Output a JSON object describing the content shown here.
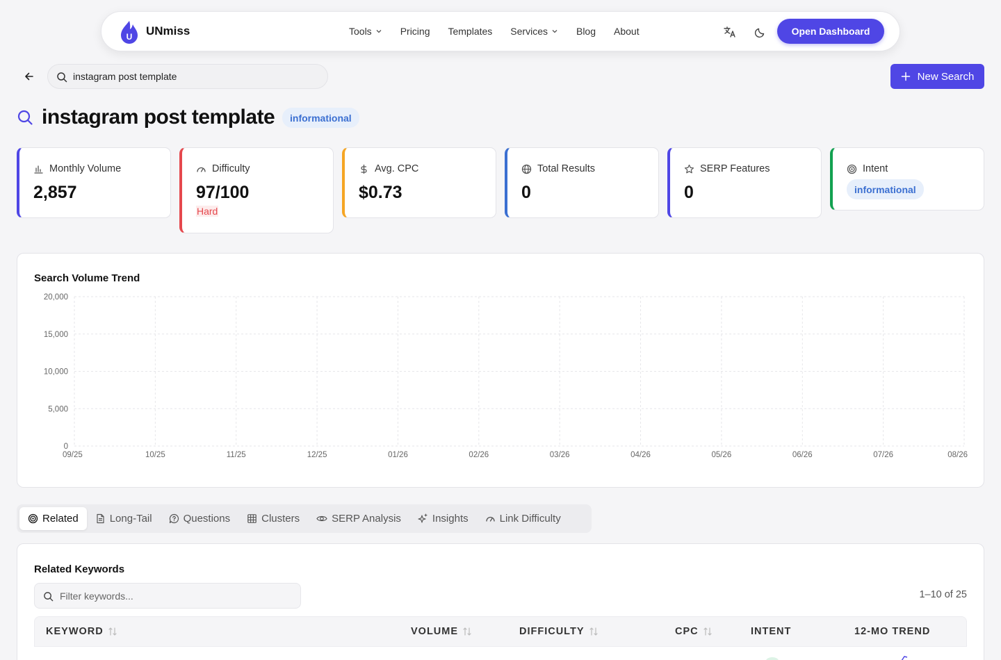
{
  "nav": {
    "brand": "UNmiss",
    "logo_letter": "U",
    "menu": [
      {
        "label": "Tools",
        "dropdown": true
      },
      {
        "label": "Pricing",
        "dropdown": false
      },
      {
        "label": "Templates",
        "dropdown": false
      },
      {
        "label": "Services",
        "dropdown": true
      },
      {
        "label": "Blog",
        "dropdown": false
      },
      {
        "label": "About",
        "dropdown": false
      }
    ],
    "icons": [
      "translate-icon",
      "moon-icon"
    ],
    "cta": "Open Dashboard"
  },
  "search": {
    "value": "instagram post template",
    "new_search": "New Search"
  },
  "page": {
    "title": "instagram post template",
    "intent_badge": "informational"
  },
  "stats": [
    {
      "label": "Monthly Volume",
      "value": "2,857",
      "icon": "bar-chart-icon",
      "color": "#4f46e5"
    },
    {
      "label": "Difficulty",
      "value": "97/100",
      "sub": "Hard",
      "icon": "gauge-icon",
      "color": "#e5484d"
    },
    {
      "label": "Avg. CPC",
      "value": "$0.73",
      "icon": "dollar-icon",
      "color": "#f5a524"
    },
    {
      "label": "Total Results",
      "value": "0",
      "icon": "globe-icon",
      "color": "#3b6fd1"
    },
    {
      "label": "SERP Features",
      "value": "0",
      "icon": "star-icon",
      "color": "#4f46e5"
    },
    {
      "label": "Intent",
      "badge": "informational",
      "icon": "target-icon",
      "color": "#12a150"
    }
  ],
  "chart_data": {
    "type": "area",
    "title": "Search Volume Trend",
    "x": [
      "09/25",
      "10/25",
      "11/25",
      "12/25",
      "01/26",
      "02/26",
      "03/26",
      "04/26",
      "05/26",
      "06/26",
      "07/26",
      "08/26"
    ],
    "ylim": [
      0,
      20000
    ],
    "yticks": [
      0,
      5000,
      10000,
      15000,
      20000
    ],
    "ytick_labels": [
      "0",
      "5,000",
      "10,000",
      "15,000",
      "20,000"
    ],
    "series": [
      {
        "values": []
      }
    ],
    "grid": true
  },
  "tabs": [
    {
      "label": "Related",
      "icon": "target-icon",
      "active": true
    },
    {
      "label": "Long-Tail",
      "icon": "document-icon",
      "active": false
    },
    {
      "label": "Questions",
      "icon": "question-bubble-icon",
      "active": false
    },
    {
      "label": "Clusters",
      "icon": "grid-icon",
      "active": false
    },
    {
      "label": "SERP Analysis",
      "icon": "eye-icon",
      "active": false
    },
    {
      "label": "Insights",
      "icon": "sparkle-icon",
      "active": false
    },
    {
      "label": "Link Difficulty",
      "icon": "gauge-icon",
      "active": false
    }
  ],
  "related": {
    "title": "Related Keywords",
    "filter_placeholder": "Filter keywords...",
    "pagination": "1–10 of 25",
    "columns": [
      {
        "label": "KEYWORD",
        "sortable": true
      },
      {
        "label": "VOLUME",
        "sortable": true
      },
      {
        "label": "DIFFICULTY",
        "sortable": true
      },
      {
        "label": "CPC",
        "sortable": true
      },
      {
        "label": "INTENT",
        "sortable": false
      },
      {
        "label": "12-MO TREND",
        "sortable": false
      }
    ]
  }
}
